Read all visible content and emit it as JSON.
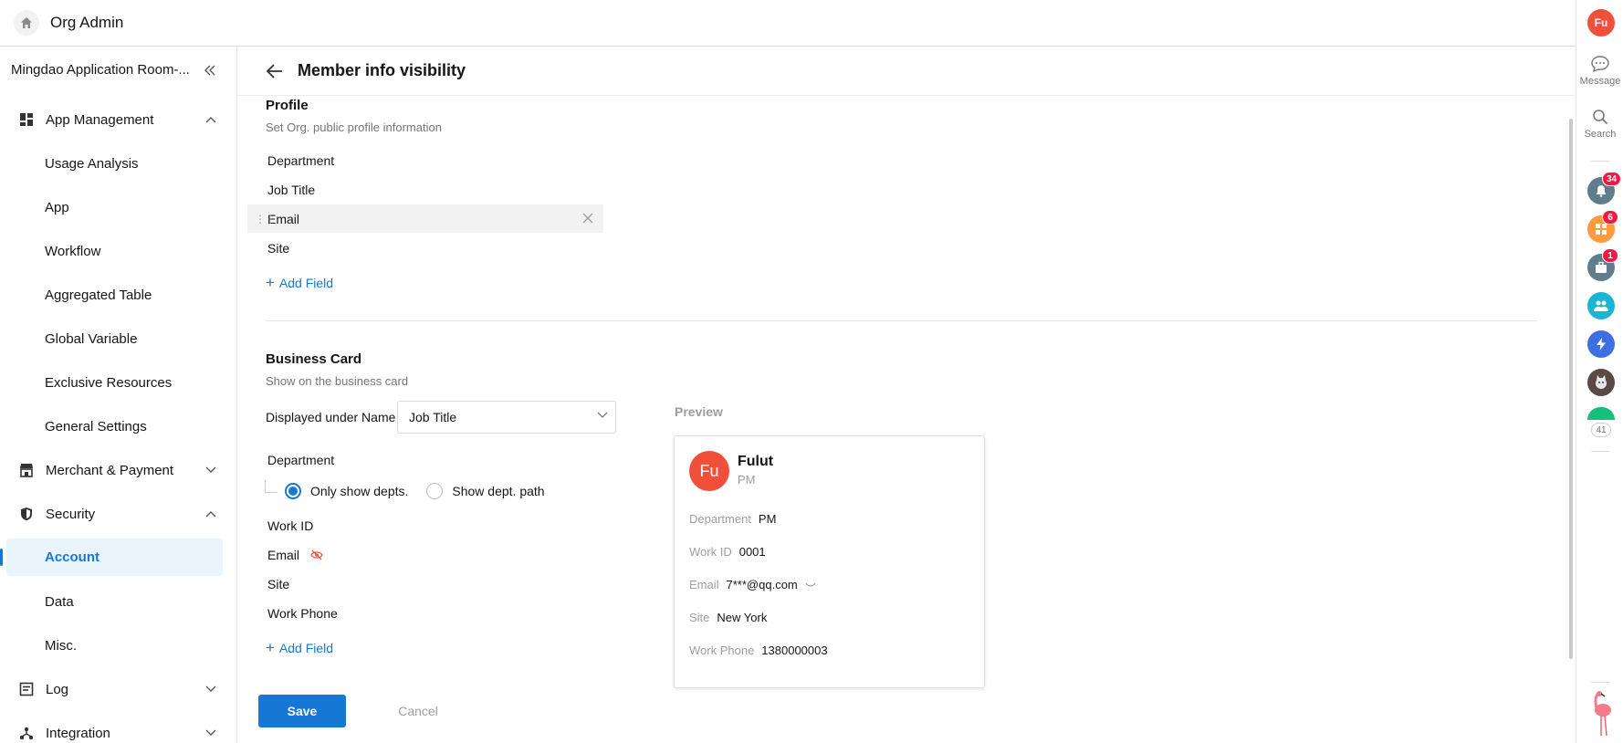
{
  "topbar": {
    "title": "Org Admin"
  },
  "sidebar": {
    "org_name": "Mingdao Application Room-...",
    "sections": [
      {
        "label": "App Management",
        "expanded": true,
        "items": [
          "Usage Analysis",
          "App",
          "Workflow",
          "Aggregated Table",
          "Global Variable",
          "Exclusive Resources",
          "General Settings"
        ]
      },
      {
        "label": "Merchant & Payment",
        "expanded": false
      },
      {
        "label": "Security",
        "expanded": true,
        "items": [
          "Account",
          "Data",
          "Misc."
        ],
        "active_item": "Account"
      },
      {
        "label": "Log",
        "expanded": false
      },
      {
        "label": "Integration",
        "expanded": false
      }
    ]
  },
  "header": {
    "title": "Member info visibility"
  },
  "profile": {
    "title": "Profile",
    "desc": "Set Org. public profile information",
    "fields": [
      "Department",
      "Job Title",
      "Email",
      "Site"
    ],
    "add_field": "Add Field"
  },
  "business_card": {
    "title": "Business Card",
    "desc": "Show on the business card",
    "under_name_label": "Displayed under Name",
    "under_name_value": "Job Title",
    "department_label": "Department",
    "radio_only": "Only show depts.",
    "radio_path": "Show dept. path",
    "fields": [
      "Work ID",
      "Email",
      "Site",
      "Work Phone"
    ],
    "add_field": "Add Field"
  },
  "preview": {
    "title": "Preview",
    "avatar_initials": "Fu",
    "name": "Fulut",
    "subtitle": "PM",
    "rows": [
      {
        "k": "Department",
        "v": "PM"
      },
      {
        "k": "Work ID",
        "v": "0001"
      },
      {
        "k": "Email",
        "v": "7***@qq.com"
      },
      {
        "k": "Site",
        "v": "New York"
      },
      {
        "k": "Work Phone",
        "v": "1380000003"
      }
    ]
  },
  "actions": {
    "save": "Save",
    "cancel": "Cancel"
  },
  "rail": {
    "avatar_initials": "Fu",
    "message": "Message",
    "search": "Search",
    "badges": {
      "notifications": "34",
      "apps": "6",
      "work": "1"
    },
    "more_count": "41"
  },
  "colors": {
    "accent": "#1677d4",
    "brand_red": "#f0503a",
    "badge": "#f51744"
  }
}
